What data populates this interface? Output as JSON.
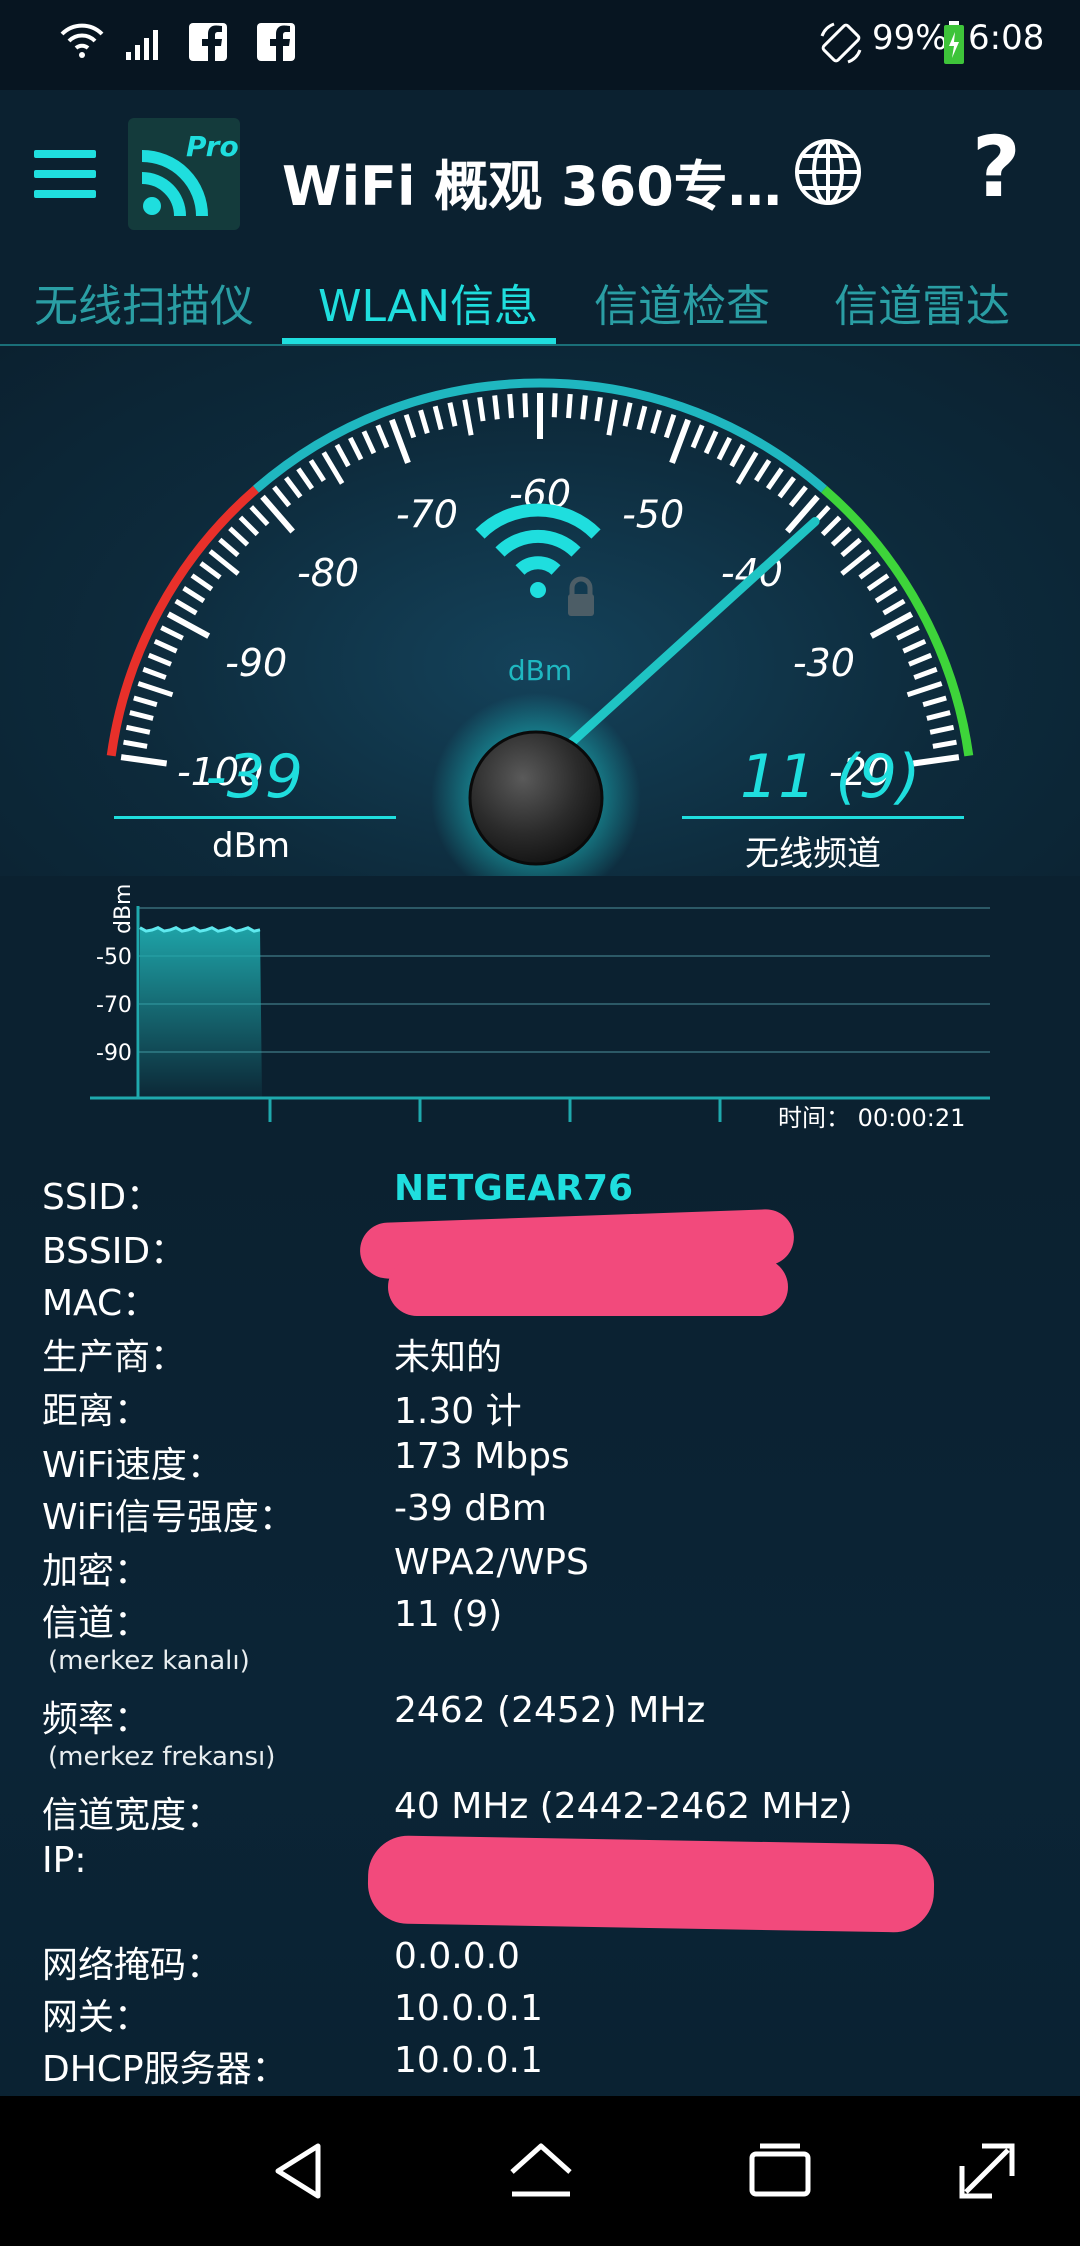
{
  "status_bar": {
    "battery": "99%",
    "time": "6:08",
    "icons": [
      "wifi-icon",
      "cell-signal-icon",
      "facebook-icon",
      "facebook-icon",
      "rotate-icon",
      "battery-icon"
    ]
  },
  "app_bar": {
    "title": "WiFi 概观 360专…",
    "logo_badge": "Pro",
    "icons": [
      "menu-icon",
      "app-logo-icon",
      "globe-icon",
      "help-icon"
    ],
    "help_glyph": "?"
  },
  "tabs": [
    {
      "label": "无线扫描仪",
      "active": false
    },
    {
      "label": "WLAN信息",
      "active": true
    },
    {
      "label": "信道检查",
      "active": false
    },
    {
      "label": "信道雷达",
      "active": false
    }
  ],
  "gauge": {
    "ticks": [
      "-100",
      "-90",
      "-80",
      "-70",
      "-60",
      "-50",
      "-40",
      "-30",
      "-20"
    ],
    "scale_min": -100,
    "scale_max": -20,
    "needle_value": -39,
    "unit_center": "dBm",
    "signal_value": "-39",
    "signal_caption": "dBm",
    "channel_value": "11 (9)",
    "channel_caption": "无线频道",
    "colors": {
      "red": "#e8302a",
      "cyan": "#1fb7c0",
      "green": "#3ed43a",
      "accent": "#1fdede"
    }
  },
  "history": {
    "ylabel": "dBm",
    "yticks": [
      "-50",
      "-70",
      "-90"
    ],
    "time_label": "时间： 00:00:21",
    "signal_level_dbm": -39
  },
  "info": {
    "ssid_label": "SSID：",
    "ssid_value": "NETGEAR76",
    "bssid_label": "BSSID：",
    "mac_label": "MAC：",
    "vendor_label": "生产商：",
    "vendor_value": "未知的",
    "distance_label": "距离：",
    "distance_value": "1.30 计",
    "speed_label": "WiFi速度：",
    "speed_value": "173 Mbps",
    "strength_label": "WiFi信号强度：",
    "strength_value": "-39 dBm",
    "encryption_label": "加密：",
    "encryption_value": "WPA2/WPS",
    "channel_label": "信道：",
    "channel_sub": "(merkez kanalı)",
    "channel_value": "11 (9)",
    "frequency_label": "频率：",
    "frequency_sub": "(merkez frekansı)",
    "frequency_value": "2462 (2452) MHz",
    "width_label": "信道宽度：",
    "width_value": "40 MHz (2442-2462 MHz)",
    "ip_label": "IP:",
    "netmask_label": "网络掩码：",
    "netmask_value": "0.0.0.0",
    "gateway_label": "网关：",
    "gateway_value": "10.0.0.1",
    "dhcp_label": "DHCP服务器：",
    "dhcp_value": "10.0.0.1"
  },
  "nav_bar": {
    "icons": [
      "back-icon",
      "home-icon",
      "recents-icon",
      "expand-icon"
    ]
  }
}
